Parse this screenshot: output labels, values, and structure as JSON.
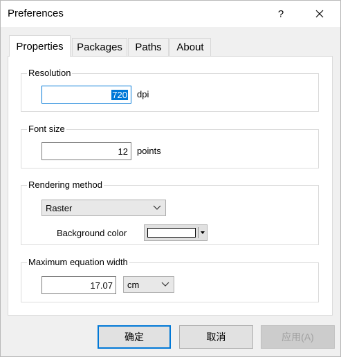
{
  "window": {
    "title": "Preferences"
  },
  "titlebar": {
    "help_label": "?",
    "close_icon": "close-icon"
  },
  "tabs": [
    {
      "label": "Properties",
      "active": true
    },
    {
      "label": "Packages",
      "active": false
    },
    {
      "label": "Paths",
      "active": false
    },
    {
      "label": "About",
      "active": false
    }
  ],
  "resolution": {
    "label": "Resolution",
    "value": "720",
    "unit": "dpi"
  },
  "font_size": {
    "label": "Font size",
    "value": "12",
    "unit": "points"
  },
  "rendering": {
    "label": "Rendering method",
    "method": "Raster",
    "background_label": "Background color",
    "background_color": "#ffffff"
  },
  "max_width": {
    "label": "Maximum equation width",
    "value": "17.07",
    "unit": "cm"
  },
  "buttons": {
    "ok": "确定",
    "cancel": "取消",
    "apply": "应用(A)"
  },
  "colors": {
    "accent": "#0078d7"
  }
}
